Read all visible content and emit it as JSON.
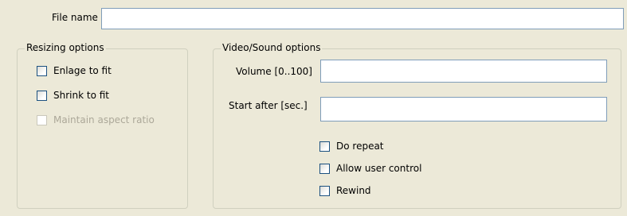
{
  "file": {
    "label": "File name",
    "value": ""
  },
  "resizing": {
    "title": "Resizing options",
    "options": [
      {
        "label": "Enlage to fit",
        "checked": false,
        "enabled": true
      },
      {
        "label": "Shrink to fit",
        "checked": false,
        "enabled": true
      },
      {
        "label": "Maintain aspect ratio",
        "checked": false,
        "enabled": false
      }
    ]
  },
  "video_sound": {
    "title": "Video/Sound options",
    "volume": {
      "label": "Volume [0..100]",
      "value": ""
    },
    "start_after": {
      "label": "Start after [sec.]",
      "value": ""
    },
    "options": [
      {
        "label": "Do repeat",
        "checked": false,
        "enabled": true
      },
      {
        "label": "Allow user control",
        "checked": false,
        "enabled": true
      },
      {
        "label": "Rewind",
        "checked": false,
        "enabled": true
      }
    ]
  }
}
